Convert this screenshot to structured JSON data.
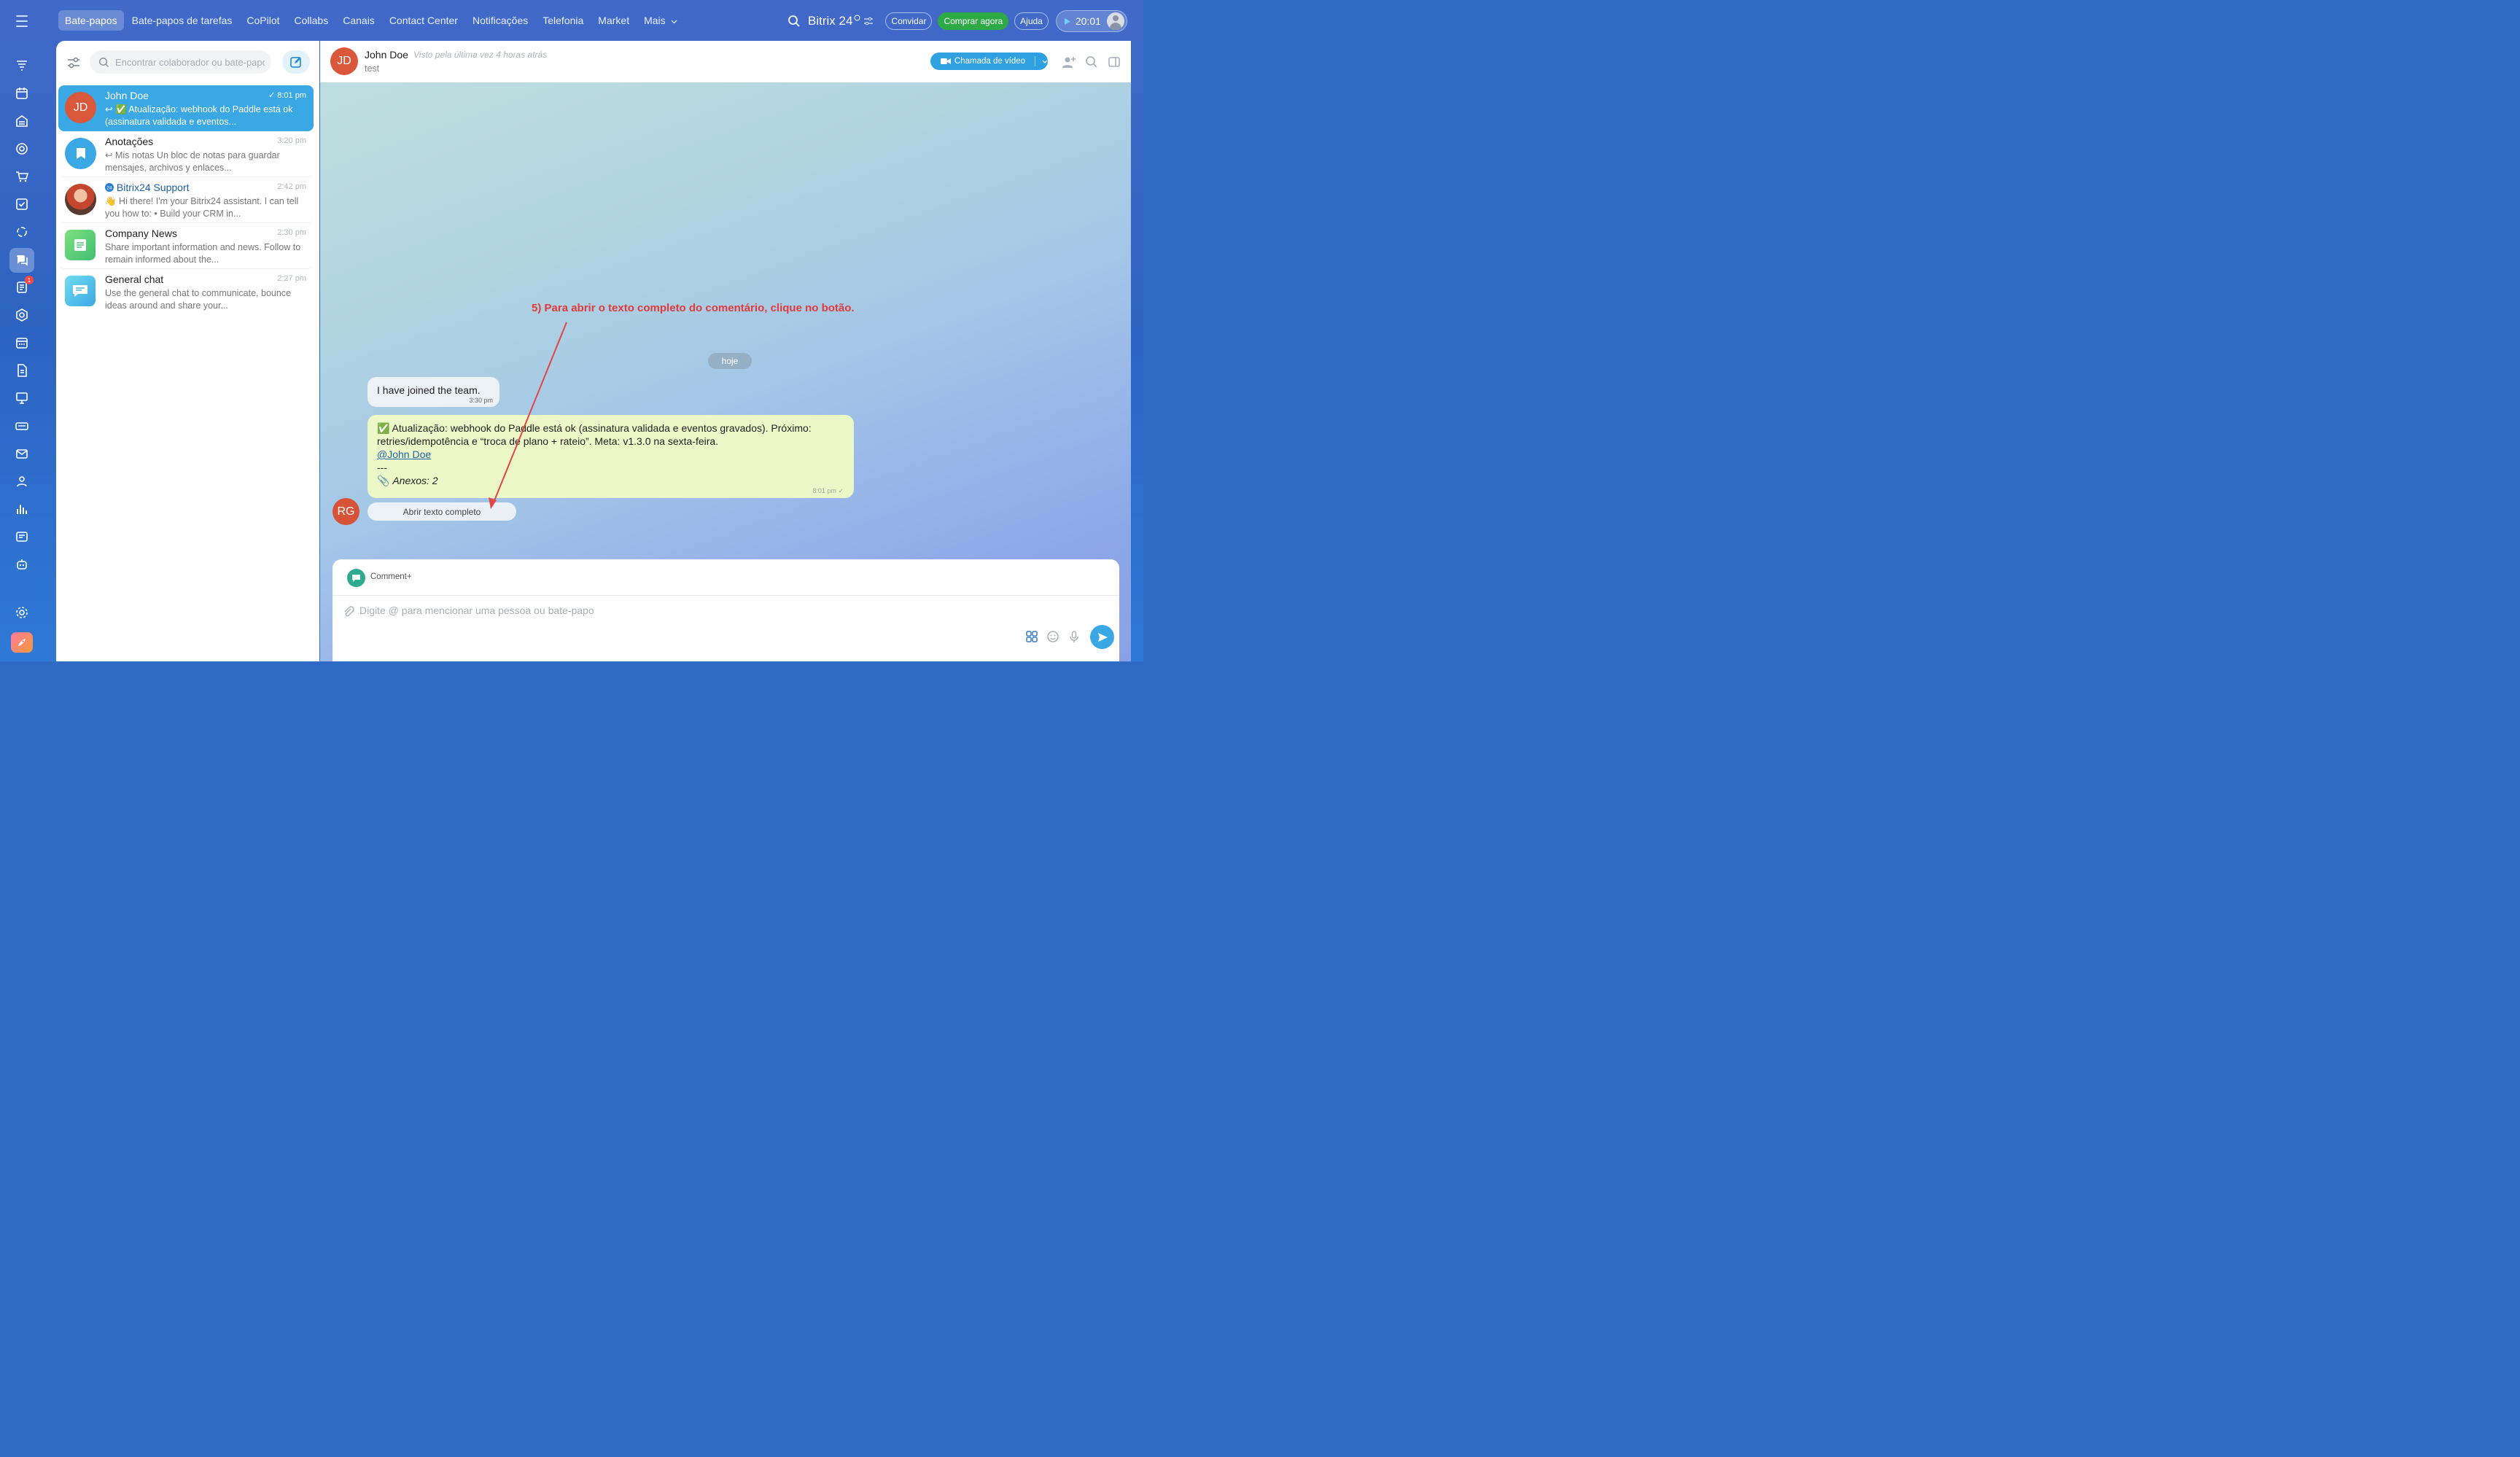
{
  "topbar": {
    "nav": [
      "Bate-papos",
      "Bate-papos de tarefas",
      "CoPilot",
      "Collabs",
      "Canais",
      "Contact Center",
      "Notificações",
      "Telefonia",
      "Market",
      "Mais"
    ],
    "brand": "Bitrix 24",
    "invite": "Convidar",
    "buy": "Comprar agora",
    "help": "Ajuda",
    "time": "20:01"
  },
  "sidebar": {
    "search_placeholder": "Encontrar colaborador ou bate-papo",
    "chats": [
      {
        "name": "John Doe",
        "time": "8:01 pm",
        "preview": "↩ ✅ Atualização: webhook do Paddle está ok (assinatura validada e eventos...",
        "avatar": "JD",
        "avatar_color": "#d9573b",
        "selected": true
      },
      {
        "name": "Anotações",
        "time": "3:20 pm",
        "preview": "↩ Mis notas Un bloc de notas para guardar mensajes, archivos y enlaces...",
        "avatar": "",
        "avatar_color": "#3aa8e5"
      },
      {
        "name": "Bitrix24 Support",
        "time": "2:42 pm",
        "preview": "👋 Hi there! I'm your Bitrix24 assistant. I can tell you how to: • Build your CRM in...",
        "avatar": "",
        "avatar_color": "#7a4a3a"
      },
      {
        "name": "Company News",
        "time": "2:30 pm",
        "preview": "Share important information and news. Follow to remain informed about the...",
        "avatar": "",
        "avatar_color": "#5ccf6d"
      },
      {
        "name": "General chat",
        "time": "2:27 pm",
        "preview": "Use the general chat to communicate, bounce ideas around and share your...",
        "avatar": "",
        "avatar_color": "#3fbde0"
      }
    ]
  },
  "chat_header": {
    "initials": "JD",
    "name": "John Doe",
    "last_seen": "Visto pela última vez 4 horas atrás",
    "status": "test",
    "video_call": "Chamada de vídeo"
  },
  "messages": {
    "date": "hoje",
    "m1_text": "I have joined the team.",
    "m1_time": "3:30 pm",
    "m2_line1": "✅ Atualização: webhook do Paddle está ok (assinatura validada e eventos gravados). Próximo: retries/idempotência e “troca de plano + rateio”. Meta: v1.3.0 na sexta-feira.",
    "m2_mention": "@John Doe",
    "m2_sep": "---",
    "m2_attach": "Anexos: 2",
    "m2_time": "8:01 pm",
    "sender_initials": "RG",
    "open_full": "Abrir texto completo"
  },
  "annotation": "5) Para abrir o texto completo do comentário, clique no botão.",
  "composer": {
    "label": "Comment+",
    "placeholder": "Digite @ para mencionar uma pessoa ou bate-papo"
  }
}
